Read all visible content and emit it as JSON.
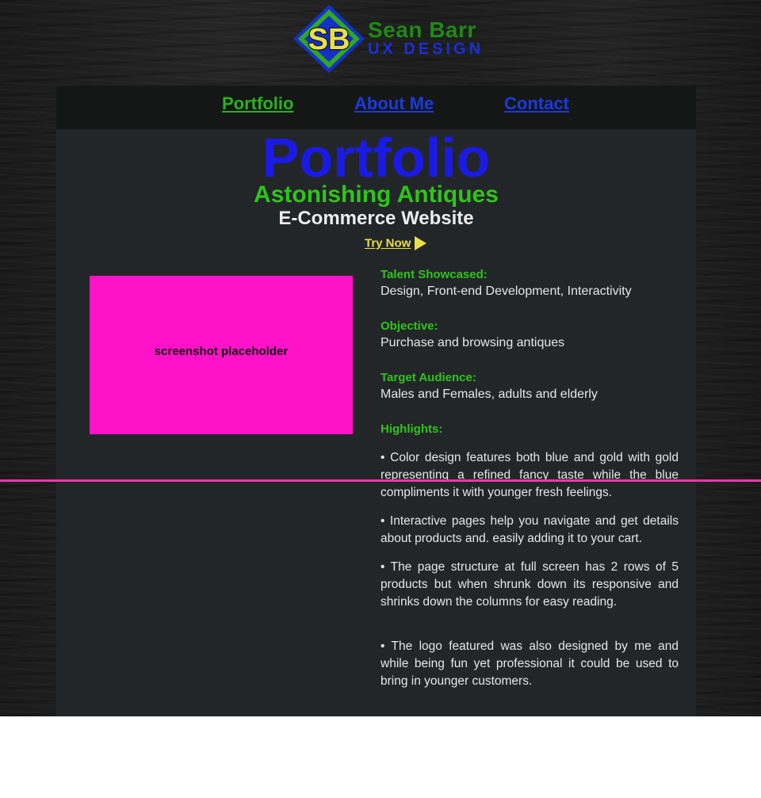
{
  "logo": {
    "monogram": "SB",
    "name": "Sean Barr",
    "subtitle": "UX DESIGN"
  },
  "nav": {
    "items": [
      {
        "label": "Portfolio",
        "active": true
      },
      {
        "label": "About Me",
        "active": false
      },
      {
        "label": "Contact",
        "active": false
      }
    ]
  },
  "main": {
    "title": "Portfolio",
    "project_name": "Astonishing Antiques",
    "project_type": "E-Commerce Website",
    "try_now": "Try Now",
    "screenshot_label": "screenshot placeholder",
    "details": {
      "talent_label": "Talent Showcased:",
      "talent_value": "Design, Front-end Development, Interactivity",
      "objective_label": "Objective:",
      "objective_value": "Purchase and browsing antiques",
      "audience_label": "Target Audience:",
      "audience_value": "Males and Females, adults and elderly",
      "highlights_label": "Highlights:",
      "highlights": [
        "• Color design features both blue and gold with gold representing a refined fancy taste while the blue compliments it with younger fresh feelings.",
        "• Interactive pages help you navigate and get details about products and. easily adding it to your cart.",
        "• The page structure at full screen has 2 rows of 5 products but when shrunk down its responsive and shrinks down the columns for easy reading.",
        "• The logo featured was also designed by me and while being fun yet professional it could be used to bring in younger customers."
      ]
    }
  },
  "colors": {
    "accent_green": "#2fc41a",
    "accent_blue": "#1a3ae0",
    "try_now_yellow": "#e8e04a",
    "placeholder_pink": "#ff12c8",
    "panel_bg": "#232628",
    "guide_line": "#e63aa8"
  }
}
